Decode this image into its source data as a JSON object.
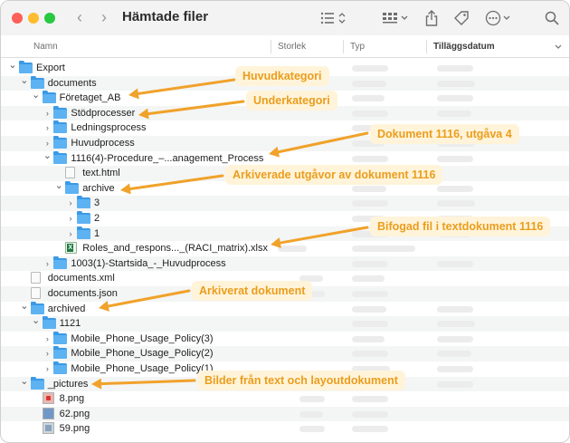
{
  "window": {
    "title": "Hämtade filer",
    "traffic_lights": {
      "close": "#fe5f57",
      "minimize": "#febc2e",
      "zoom": "#28c840"
    },
    "accent_color": "#f0a22a"
  },
  "toolbar": {
    "back_icon": "chevron-left-icon",
    "forward_icon": "chevron-right-icon",
    "list_view_icon": "list-icon",
    "group_icon": "grid-icon",
    "share_icon": "share-icon",
    "tag_icon": "tag-icon",
    "more_icon": "ellipsis-circle-icon",
    "search_icon": "search-icon"
  },
  "columns": {
    "name": "Namn",
    "size": "Storlek",
    "kind": "Typ",
    "date_added": "Tilläggsdatum"
  },
  "rows": [
    {
      "name": "Export",
      "type": "folder",
      "expanded": true
    },
    {
      "name": "documents",
      "type": "folder",
      "expanded": true
    },
    {
      "name": "Företaget_AB",
      "type": "folder",
      "expanded": true
    },
    {
      "name": "Stödprocesser",
      "type": "folder",
      "expanded": false
    },
    {
      "name": "Ledningsprocess",
      "type": "folder",
      "expanded": false
    },
    {
      "name": "Huvudprocess",
      "type": "folder",
      "expanded": false
    },
    {
      "name": "1116(4)-Procedure_–...anagement_Process",
      "type": "folder",
      "expanded": true
    },
    {
      "name": "text.html",
      "type": "file"
    },
    {
      "name": "archive",
      "type": "folder",
      "expanded": true
    },
    {
      "name": "3",
      "type": "folder",
      "expanded": false
    },
    {
      "name": "2",
      "type": "folder",
      "expanded": false
    },
    {
      "name": "1",
      "type": "folder",
      "expanded": false
    },
    {
      "name": "Roles_and_respons..._(RACI_matrix).xlsx",
      "type": "xlsx"
    },
    {
      "name": "1003(1)-Startsida_-_Huvudprocess",
      "type": "folder",
      "expanded": false
    },
    {
      "name": "documents.xml",
      "type": "file"
    },
    {
      "name": "documents.json",
      "type": "file"
    },
    {
      "name": "archived",
      "type": "folder",
      "expanded": true
    },
    {
      "name": "1121",
      "type": "folder",
      "expanded": true
    },
    {
      "name": "Mobile_Phone_Usage_Policy(3)",
      "type": "folder",
      "expanded": false
    },
    {
      "name": "Mobile_Phone_Usage_Policy(2)",
      "type": "folder",
      "expanded": false
    },
    {
      "name": "Mobile_Phone_Usage_Policy(1)",
      "type": "folder",
      "expanded": false
    },
    {
      "name": "_pictures",
      "type": "folder",
      "expanded": true
    },
    {
      "name": "8.png",
      "type": "png"
    },
    {
      "name": "62.png",
      "type": "png"
    },
    {
      "name": "59.png",
      "type": "png"
    }
  ],
  "callouts": [
    "Huvudkategori",
    "Underkategori",
    "Dokument 1116, utgåva 4",
    "Arkiverade utgåvor av dokument 1116",
    "Bifogad fil i textdokument 1116",
    "Arkiverat dokument",
    "Bilder från text och layoutdokument"
  ]
}
